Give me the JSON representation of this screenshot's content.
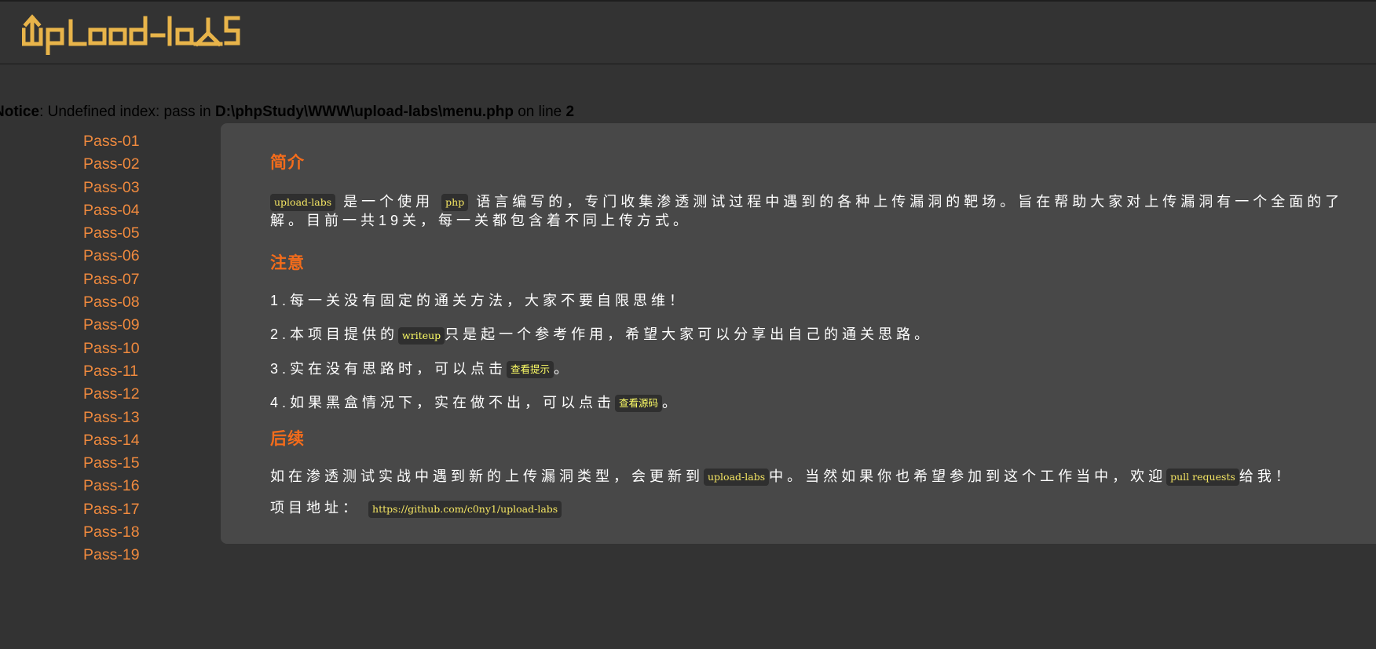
{
  "header": {
    "logo_text": "upload-labs"
  },
  "notice": {
    "label": "Notice",
    "message": ": Undefined index: pass in ",
    "path": "D:\\phpStudy\\WWW\\upload-labs\\menu.php",
    "line_text": " on line ",
    "line_number": "2"
  },
  "menu": {
    "items": [
      "Pass-01",
      "Pass-02",
      "Pass-03",
      "Pass-04",
      "Pass-05",
      "Pass-06",
      "Pass-07",
      "Pass-08",
      "Pass-09",
      "Pass-10",
      "Pass-11",
      "Pass-12",
      "Pass-13",
      "Pass-14",
      "Pass-15",
      "Pass-16",
      "Pass-17",
      "Pass-18",
      "Pass-19"
    ]
  },
  "content": {
    "intro_title": "简介",
    "intro_code1": "upload-labs",
    "intro_text1": "是一个使用",
    "intro_code2": "php",
    "intro_text2": "语言编写的，专门收集渗透测试过程中遇到的各种上传漏洞的靶场。旨在帮助大家对上传漏洞有一个全面的了",
    "intro_text3": "解。目前一共19关，每一关都包含着不同上传方式。",
    "notes_title": "注意",
    "note1": "1.每一关没有固定的通关方法，大家不要自限思维！",
    "note2_a": "2.本项目提供的",
    "note2_code": "writeup",
    "note2_b": "只是起一个参考作用，希望大家可以分享出自己的通关思路。",
    "note3_a": "3.实在没有思路时，可以点击",
    "note3_link": "查看提示",
    "note3_b": "。",
    "note4_a": "4.如果黑盒情况下，实在做不出，可以点击",
    "note4_link": "查看源码",
    "note4_b": "。",
    "follow_title": "后续",
    "follow_a": "如在渗透测试实战中遇到新的上传漏洞类型，会更新到",
    "follow_code1": "upload-labs",
    "follow_b": "中。当然如果你也希望参加到这个工作当中，欢迎",
    "follow_code2": "pull requests",
    "follow_c": "给我！",
    "address_label": "项目地址：",
    "address_url": "https://github.com/c0ny1/upload-labs"
  },
  "colors": {
    "background": "#333333",
    "panel": "#484848",
    "menu_link": "#f08a3e",
    "heading": "#f46c1b",
    "logo": "#e8b44a",
    "code_text": "#f5e663"
  }
}
